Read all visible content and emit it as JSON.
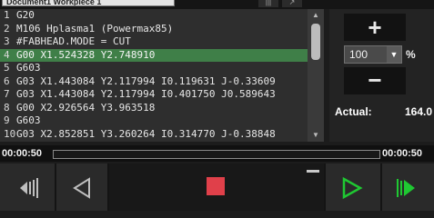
{
  "window": {
    "title": "Document1 Workpiece 1"
  },
  "top_buttons": [
    "|||",
    "↗"
  ],
  "code": {
    "selected_line": 4,
    "lines": [
      {
        "n": "1",
        "text": "G20"
      },
      {
        "n": "2",
        "text": "M106 Hplasma1 (Powermax85)"
      },
      {
        "n": "3",
        "text": "#FABHEAD.MODE = CUT"
      },
      {
        "n": "4",
        "text": "G00 X1.524328 Y2.748910"
      },
      {
        "n": "5",
        "text": "G603"
      },
      {
        "n": "6",
        "text": "G03 X1.443084 Y2.117994 I0.119631 J-0.33609"
      },
      {
        "n": "7",
        "text": "G03 X1.443084 Y2.117994 I0.401750 J0.589643"
      },
      {
        "n": "8",
        "text": "G00 X2.926564 Y3.963518"
      },
      {
        "n": "9",
        "text": "G603"
      },
      {
        "n": "10",
        "text": "G03 X2.852851 Y3.260264 I0.314770 J-0.38848"
      }
    ]
  },
  "zoom": {
    "plus_label": "+",
    "minus_label": "−",
    "value": "100",
    "unit": "%",
    "dropdown_glyph": "▼"
  },
  "actual": {
    "label": "Actual:",
    "value": "164.0"
  },
  "timeline": {
    "elapsed": "00:00:50",
    "total": "00:00:50"
  },
  "controls": {
    "colors": {
      "stop": "#e0404a",
      "play": "#1fc832",
      "step": "#1fc832",
      "icon": "#bfbfbf"
    }
  },
  "scroll": {
    "up": "▲",
    "down": "▼"
  }
}
